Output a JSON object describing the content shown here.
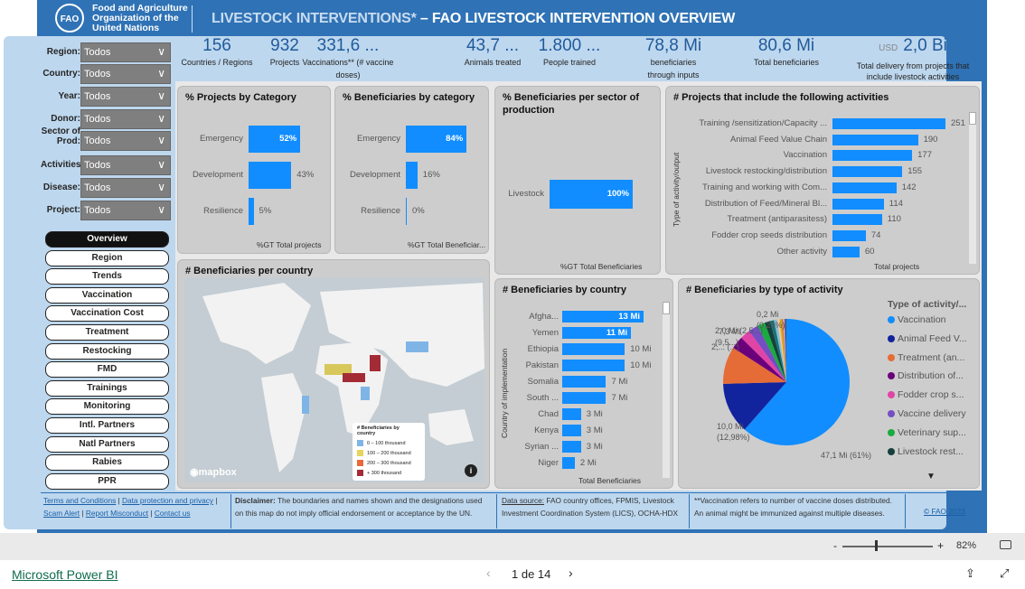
{
  "header": {
    "logo_text": [
      "Food and Agriculture",
      "Organization of the",
      "United Nations"
    ],
    "title_a": "LIVESTOCK INTERVENTIONS*",
    "title_b": " – FAO LIVESTOCK INTERVENTION OVERVIEW"
  },
  "kpis": [
    {
      "value": "156",
      "label": "Countries / Regions"
    },
    {
      "value": "932",
      "label": "Projects"
    },
    {
      "value": "331,6 ...",
      "label": "Vaccinations** (# vaccine doses)"
    },
    {
      "value": "43,7 ...",
      "label": "Animals treated"
    },
    {
      "value": "1.800 ...",
      "label": "People trained"
    },
    {
      "value": "78,8 Mi",
      "label": "beneficiaries through inputs"
    },
    {
      "value": "80,6 Mi",
      "label": "Total beneficiaries"
    }
  ],
  "delivery": {
    "currency": "USD",
    "value": "2,0 Bi",
    "label": "Total delivery from projects that include livestock activities"
  },
  "filters": [
    {
      "label": "Region:",
      "value": "Todos"
    },
    {
      "label": "Country:",
      "value": "Todos"
    },
    {
      "label": "Year:",
      "value": "Todos"
    },
    {
      "label": "Donor:",
      "value": "Todos"
    },
    {
      "label": "Sector of Prod:",
      "value": "Todos"
    },
    {
      "label": "Activities",
      "value": "Todos"
    },
    {
      "label": "Disease:",
      "value": "Todos"
    },
    {
      "label": "Project:",
      "value": "Todos"
    }
  ],
  "nav": [
    "Overview",
    "Region",
    "Trends",
    "Vaccination",
    "Vaccination Cost",
    "Treatment",
    "Restocking",
    "FMD",
    "Trainings",
    "Monitoring",
    "Intl. Partners",
    "Natl Partners",
    "Rabies",
    "PPR"
  ],
  "nav_active": "Overview",
  "chart_data": [
    {
      "type": "bar",
      "orientation": "horizontal",
      "title": "% Projects by Category",
      "xlabel": "%GT Total projects",
      "categories": [
        "Emergency",
        "Development",
        "Resilience"
      ],
      "values": [
        52,
        43,
        5
      ],
      "labels": [
        "52%",
        "43%",
        "5%"
      ],
      "color": "#118dff"
    },
    {
      "type": "bar",
      "orientation": "horizontal",
      "title": "% Beneficiaries by category",
      "xlabel": "%GT Total Beneficiar...",
      "categories": [
        "Emergency",
        "Development",
        "Resilience"
      ],
      "values": [
        84,
        16,
        0
      ],
      "labels": [
        "84%",
        "16%",
        "0%"
      ],
      "color": "#118dff"
    },
    {
      "type": "bar",
      "orientation": "horizontal",
      "title": "% Beneficiaries per sector of production",
      "xlabel": "%GT Total Beneficiaries",
      "categories": [
        "Livestock"
      ],
      "values": [
        100
      ],
      "labels": [
        "100%"
      ],
      "color": "#118dff"
    },
    {
      "type": "bar",
      "orientation": "horizontal",
      "title": "# Projects that include the following activities",
      "ylabel": "Type of activity/output",
      "xlabel": "Total projects",
      "categories": [
        "Training /sensitization/Capacity ...",
        "Animal Feed Value Chain",
        "Vaccination",
        "Livestock restocking/distribution",
        "Training and working with Com...",
        "Distribution of Feed/Mineral Bl...",
        "Treatment (antiparasitess)",
        "Fodder crop seeds distribution",
        "Other activity"
      ],
      "values": [
        251,
        190,
        177,
        155,
        142,
        114,
        110,
        74,
        60
      ],
      "labels": [
        "251",
        "190",
        "177",
        "155",
        "142",
        "114",
        "110",
        "74",
        "60"
      ],
      "color": "#118dff"
    },
    {
      "type": "bar",
      "orientation": "horizontal",
      "title": "# Beneficiaries by country",
      "ylabel": "Country of implementation",
      "xlabel": "Total Beneficiaries",
      "categories": [
        "Afgha...",
        "Yemen",
        "Ethiopia",
        "Pakistan",
        "Somalia",
        "South ...",
        "Chad",
        "Kenya",
        "Syrian ...",
        "Niger"
      ],
      "values": [
        13,
        11,
        10,
        10,
        7,
        7,
        3,
        3,
        3,
        2
      ],
      "labels": [
        "13 Mi",
        "11 Mi",
        "10 Mi",
        "10 Mi",
        "7 Mi",
        "7 Mi",
        "3 Mi",
        "3 Mi",
        "3 Mi",
        "2 Mi"
      ],
      "color": "#118dff"
    },
    {
      "type": "pie",
      "title": "# Beneficiaries by type of activity",
      "legend_title": "Type of activity/...",
      "legend_position": "right",
      "slices": [
        {
          "name": "Vaccination",
          "value": 61,
          "color": "#118dff"
        },
        {
          "name": "Animal Feed V...",
          "value": 12.98,
          "color": "#12239e"
        },
        {
          "name": "Treatment (an...",
          "value": 9.5,
          "color": "#e66c37"
        },
        {
          "name": "Distribution of...",
          "value": 3.2,
          "color": "#6b007b"
        },
        {
          "name": "Fodder crop s...",
          "value": 2.6,
          "color": "#e044a7"
        },
        {
          "name": "Vaccine delivery",
          "value": 2.5,
          "color": "#744ec2"
        },
        {
          "name": "Veterinary sup...",
          "value": 1.9,
          "color": "#1aab40"
        },
        {
          "name": "Livestock rest...",
          "value": 1.4,
          "color": "#15403c"
        },
        {
          "value": 1.0,
          "color": "#197278"
        },
        {
          "value": 0.8,
          "color": "#7fbfd5"
        },
        {
          "value": 0.6,
          "color": "#f5c4af"
        },
        {
          "value": 0.5,
          "color": "#d9b300"
        },
        {
          "value": 0.4,
          "color": "#e66c37"
        },
        {
          "value": 0.3,
          "color": "#a0d1ff"
        },
        {
          "value": 0.23,
          "color": "#744ec2"
        },
        {
          "value": 0.3,
          "color": "#555555"
        }
      ],
      "data_labels": [
        "47,1 Mi (61%)",
        "10,0 Mi",
        "(12,98%)",
        "7,3 Mi",
        "(9,5...)",
        "2,... (...)",
        "2,0 Mi (2,5...)",
        "0,2 Mi",
        "(0,23%)"
      ]
    }
  ],
  "map": {
    "title": "# Beneficiaries per country",
    "legend_title": "# Beneficiaries by country",
    "legend": [
      {
        "label": "0 – 100 thousand",
        "color": "#7fb5e6"
      },
      {
        "label": "100 – 200 thousand",
        "color": "#e8d35c"
      },
      {
        "label": "200 – 300 thousand",
        "color": "#e8693a"
      },
      {
        "label": "+ 300 thousand",
        "color": "#a32b36"
      }
    ],
    "attribution": "mapbox"
  },
  "footer": {
    "links": [
      "Terms and Conditions",
      "Data protection and privacy",
      "Scam Alert",
      "Report Misconduct",
      "Contact us"
    ],
    "disclaimer_label": "Disclaimer:",
    "disclaimer": " The boundaries and names shown and the designations used on this map do not imply official endorsement or acceptance by the UN.",
    "source_label": "Data source:",
    "source": " FAO country offices, FPMIS, Livestock Investment Coordination System (LICS), OCHA-HDX",
    "note": "**Vaccination refers to number of vaccine doses distributed. An animal might be immunized against multiple diseases.",
    "copyright": "© FAO 2023"
  },
  "bottom": {
    "zoom": "82%",
    "minus": "-",
    "plus": "+",
    "brand": "Microsoft Power BI",
    "page": "1 de 14"
  }
}
